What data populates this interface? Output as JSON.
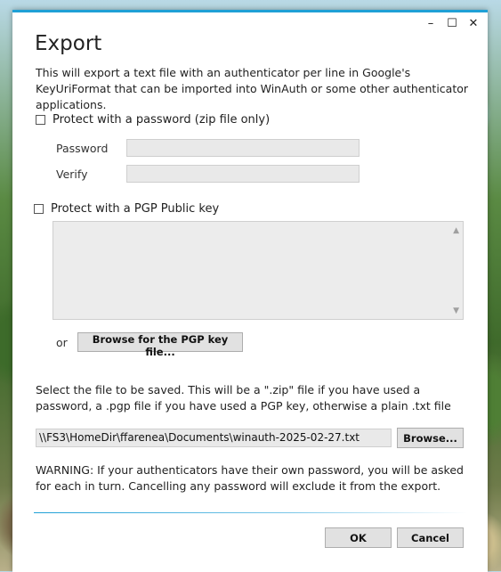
{
  "window": {
    "title": "Export",
    "controls": {
      "minimize": "–",
      "maximize": "☐",
      "close": "✕"
    }
  },
  "description": "This will export a text file with an authenticator per line in Google's KeyUriFormat that can be imported into WinAuth or some other authenticator applications.",
  "password_section": {
    "checkbox_label": "Protect with a password (zip file only)",
    "checked": false,
    "password_label": "Password",
    "verify_label": "Verify",
    "password_value": "",
    "verify_value": ""
  },
  "pgp_section": {
    "checkbox_label": "Protect with a PGP Public key",
    "checked": false,
    "key_text": "",
    "or_label": "or",
    "browse_label": "Browse for the PGP key file..."
  },
  "file_section": {
    "instructions": "Select the file to be saved. This will be a \".zip\" file if you have used a password, a .pgp file if you have used a PGP key, otherwise a plain .txt file",
    "path": "\\\\FS3\\HomeDir\\ffarenea\\Documents\\winauth-2025-02-27.txt",
    "browse_label": "Browse..."
  },
  "warning": "WARNING: If your authenticators have their own password, you will be asked for each in turn. Cancelling any password will exclude it from the export.",
  "buttons": {
    "ok": "OK",
    "cancel": "Cancel"
  },
  "colors": {
    "accent": "#1fa0d6"
  }
}
